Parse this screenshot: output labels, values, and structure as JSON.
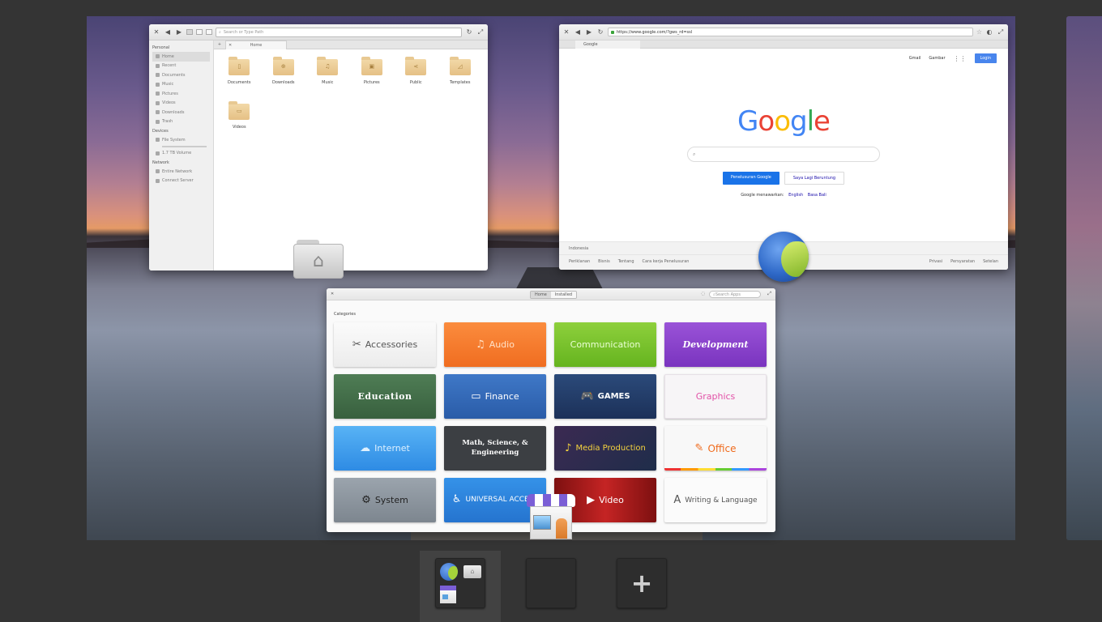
{
  "file_manager": {
    "search_placeholder": "Search or Type Path",
    "tab_label": "Home",
    "sidebar": {
      "personal_header": "Personal",
      "personal": [
        "Home",
        "Recent",
        "Documents",
        "Music",
        "Pictures",
        "Videos",
        "Downloads",
        "Trash"
      ],
      "devices_header": "Devices",
      "devices": [
        "File System",
        "1.7 TB Volume"
      ],
      "network_header": "Network",
      "network": [
        "Entire Network",
        "Connect Server"
      ]
    },
    "folders": [
      {
        "label": "Documents",
        "icon": "document-icon",
        "glyph": "▯"
      },
      {
        "label": "Downloads",
        "icon": "download-icon",
        "glyph": "⊕"
      },
      {
        "label": "Music",
        "icon": "music-icon",
        "glyph": "♫"
      },
      {
        "label": "Pictures",
        "icon": "picture-icon",
        "glyph": "▣"
      },
      {
        "label": "Public",
        "icon": "share-icon",
        "glyph": "⋖"
      },
      {
        "label": "Templates",
        "icon": "template-icon",
        "glyph": "◿"
      },
      {
        "label": "Videos",
        "icon": "video-icon",
        "glyph": "▭"
      }
    ]
  },
  "browser": {
    "url": "https://www.google.com/?gws_rd=ssl",
    "tab_title": "Google",
    "gmail": "Gmail",
    "images": "Gambar",
    "login": "Login",
    "search_button": "Penelusuran Google",
    "lucky_button": "Saya Lagi Beruntung",
    "offered_in": "Google menawarkan:",
    "lang1": "English",
    "lang2": "Basa Bali",
    "country": "Indonesia",
    "footer_left": [
      "Periklanan",
      "Bisnis",
      "Tentang",
      "Cara kerja Penelusuran"
    ],
    "footer_right": [
      "Privasi",
      "Persyaratan",
      "Setelan"
    ]
  },
  "appcenter": {
    "tab_home": "Home",
    "tab_installed": "Installed",
    "search_placeholder": "Search Apps",
    "categories_label": "Categories",
    "categories": [
      {
        "label": "Accessories",
        "icon": "accessories-icon",
        "glyph": "✂"
      },
      {
        "label": "Audio",
        "icon": "audio-icon",
        "glyph": "♫"
      },
      {
        "label": "Communication",
        "icon": "",
        "glyph": ""
      },
      {
        "label": "Development",
        "icon": "",
        "glyph": ""
      },
      {
        "label": "Education",
        "icon": "",
        "glyph": ""
      },
      {
        "label": "Finance",
        "icon": "credit-card-icon",
        "glyph": "▭"
      },
      {
        "label": "GAMES",
        "icon": "gamepad-icon",
        "glyph": "🎮"
      },
      {
        "label": "Graphics",
        "icon": "",
        "glyph": ""
      },
      {
        "label": "Internet",
        "icon": "cloud-icon",
        "glyph": "☁"
      },
      {
        "label": "Math, Science, & Engineering",
        "icon": "",
        "glyph": ""
      },
      {
        "label": "Media Production",
        "icon": "media-icon",
        "glyph": "♪"
      },
      {
        "label": "Office",
        "icon": "pencil-icon",
        "glyph": "✎"
      },
      {
        "label": "System",
        "icon": "gear-icon",
        "glyph": "⚙"
      },
      {
        "label": "UNIVERSAL ACCESS",
        "icon": "accessibility-icon",
        "glyph": "♿"
      },
      {
        "label": "Video",
        "icon": "play-icon",
        "glyph": "▶"
      },
      {
        "label": "Writing & Language",
        "icon": "writing-icon",
        "glyph": "A"
      }
    ]
  },
  "workspace_switcher": {
    "add_glyph": "+"
  }
}
